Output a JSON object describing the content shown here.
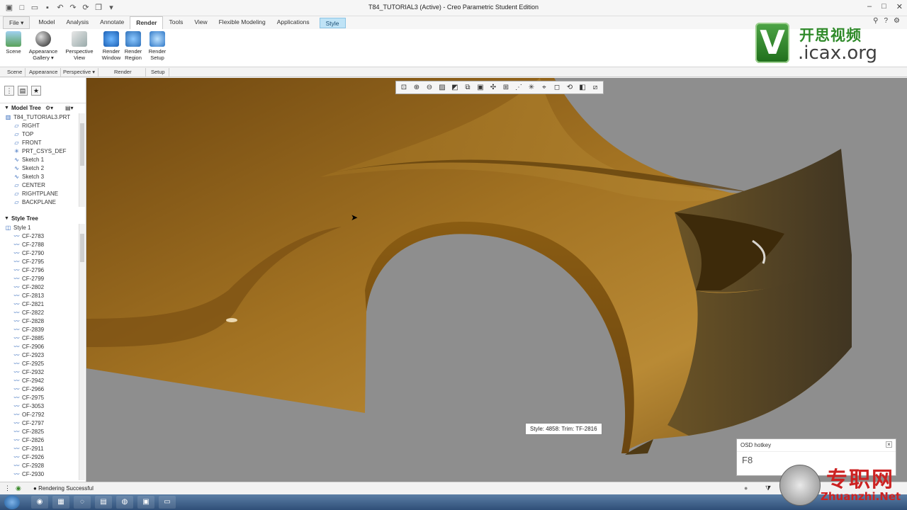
{
  "window": {
    "title": "T84_TUTORIAL3 (Active) - Creo Parametric Student Edition"
  },
  "menu_tabs": [
    {
      "label": "File",
      "id": "file"
    },
    {
      "label": "Model",
      "id": "model"
    },
    {
      "label": "Analysis",
      "id": "analysis"
    },
    {
      "label": "Annotate",
      "id": "annotate"
    },
    {
      "label": "Render",
      "id": "render",
      "active": true
    },
    {
      "label": "Tools",
      "id": "tools"
    },
    {
      "label": "View",
      "id": "view"
    },
    {
      "label": "Flexible Modeling",
      "id": "flexible-modeling"
    },
    {
      "label": "Applications",
      "id": "applications"
    },
    {
      "label": "Style",
      "id": "style"
    }
  ],
  "ribbon": {
    "scene": "Scene",
    "appearance_gallery": "Appearance Gallery",
    "perspective_view": "Perspective View",
    "render_window": "Render Window",
    "render_region": "Render Region",
    "render_setup": "Render Setup"
  },
  "groups": {
    "scene": "Scene",
    "appearance": "Appearance",
    "perspective": "Perspective",
    "render": "Render",
    "setup": "Setup"
  },
  "logo": {
    "cn": "开思视频",
    "en": ".icax.org"
  },
  "model_tree": {
    "header": "Model Tree",
    "items": [
      {
        "label": "T84_TUTORIAL3.PRT",
        "icon": "part-icon"
      },
      {
        "label": "RIGHT",
        "icon": "datum-plane-icon"
      },
      {
        "label": "TOP",
        "icon": "datum-plane-icon"
      },
      {
        "label": "FRONT",
        "icon": "datum-plane-icon"
      },
      {
        "label": "PRT_CSYS_DEF",
        "icon": "csys-icon"
      },
      {
        "label": "Sketch 1",
        "icon": "sketch-icon"
      },
      {
        "label": "Sketch 2",
        "icon": "sketch-icon"
      },
      {
        "label": "Sketch 3",
        "icon": "sketch-icon"
      },
      {
        "label": "CENTER",
        "icon": "datum-plane-icon"
      },
      {
        "label": "RIGHTPLANE",
        "icon": "datum-plane-icon"
      },
      {
        "label": "BACKPLANE",
        "icon": "datum-plane-icon"
      }
    ]
  },
  "style_tree": {
    "header": "Style Tree",
    "items": [
      "Style 1",
      "CF-2783",
      "CF-2788",
      "CF-2790",
      "CF-2795",
      "CF-2796",
      "CF-2799",
      "CF-2802",
      "CF-2813",
      "CF-2821",
      "CF-2822",
      "CF-2828",
      "CF-2839",
      "CF-2885",
      "CF-2906",
      "CF-2923",
      "CF-2925",
      "CF-2932",
      "CF-2942",
      "CF-2966",
      "CF-2975",
      "CF-3053",
      "OF-2792",
      "CF-2797",
      "CF-2825",
      "CF-2826",
      "CF-2911",
      "CF-2926",
      "CF-2928",
      "CF-2930"
    ]
  },
  "tooltip": "Style: 4858: Trim:   TF-2816",
  "osd": {
    "header": "OSD hotkey",
    "key": "F8"
  },
  "status": {
    "message": "Rendering Successful"
  },
  "watermark": {
    "cn": "专职网",
    "en": "Zhuanzhi.Net"
  },
  "colors": {
    "accent": "#bfe3f6",
    "viewport": "#8e8e8e",
    "surface": "#a9751e"
  }
}
